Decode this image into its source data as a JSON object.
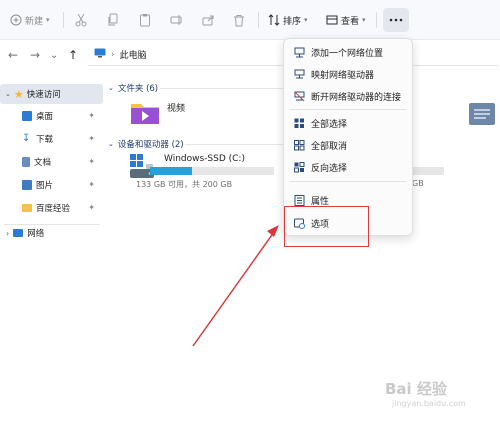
{
  "toolbar": {
    "new_label": "新建",
    "sort_label": "排序",
    "view_label": "查看"
  },
  "address": {
    "path": "此电脑"
  },
  "sidebar": {
    "quick_access": "快速访问",
    "items": [
      {
        "label": "桌面"
      },
      {
        "label": "下载"
      },
      {
        "label": "文档"
      },
      {
        "label": "图片"
      },
      {
        "label": "百度经验"
      }
    ],
    "network": "网络"
  },
  "main": {
    "folders_header": "文件夹 (6)",
    "folder_name": "视频",
    "drives_header": "设备和驱动器 (2)",
    "drive_name": "Windows-SSD (C:)",
    "drive_info": "133 GB 可用，共 200 GB",
    "drive_used_fraction": 0.335,
    "partial_text": "GB"
  },
  "menu": {
    "items": [
      {
        "label": "添加一个网络位置"
      },
      {
        "label": "映射网络驱动器"
      },
      {
        "label": "断开网络驱动器的连接"
      },
      {
        "label": "全部选择"
      },
      {
        "label": "全部取消"
      },
      {
        "label": "反向选择"
      },
      {
        "label": "属性"
      },
      {
        "label": "选项"
      }
    ]
  },
  "watermark": {
    "text": "Bai 经验",
    "sub": "jingyan.baidu.com"
  },
  "colors": {
    "accent": "#26a0da",
    "annotation": "#e03a3a"
  }
}
